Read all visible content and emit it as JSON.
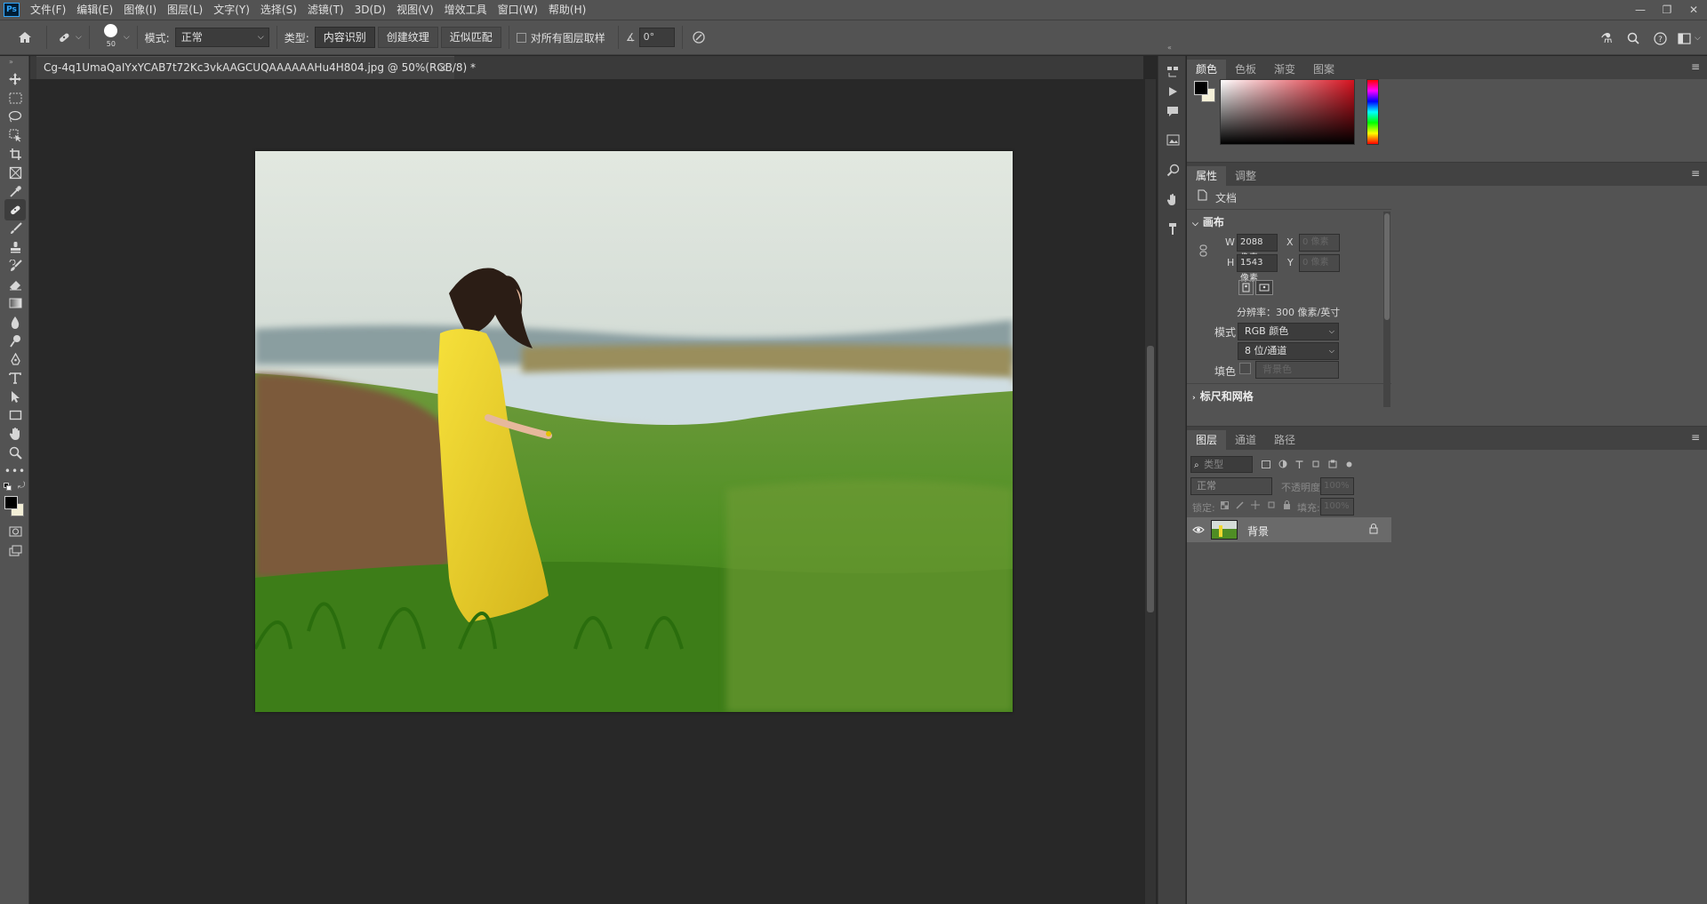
{
  "app": {
    "logo": "Ps",
    "menu": [
      "文件(F)",
      "编辑(E)",
      "图像(I)",
      "图层(L)",
      "文字(Y)",
      "选择(S)",
      "滤镜(T)",
      "3D(D)",
      "视图(V)",
      "增效工具",
      "窗口(W)",
      "帮助(H)"
    ],
    "window_controls": [
      "—",
      "❐",
      "✕"
    ]
  },
  "options": {
    "brush_size": "50",
    "mode_label": "模式:",
    "mode_value": "正常",
    "type_label": "类型:",
    "types": [
      "内容识别",
      "创建纹理",
      "近似匹配"
    ],
    "sample_all_layers": "对所有图层取样",
    "angle_value": "0°"
  },
  "document": {
    "tab_title": "Cg-4q1UmaQaIYxYCAB7t72Kc3vkAAGCUQAAAAAAHu4H804.jpg @ 50%(RGB/8) *",
    "close": "×"
  },
  "color_panel": {
    "tabs": [
      "颜色",
      "色板",
      "渐变",
      "图案"
    ],
    "foreground": "#000000",
    "background": "#f3efd7"
  },
  "properties_panel": {
    "tabs": [
      "属性",
      "调整"
    ],
    "doc_label": "文档",
    "canvas_section": "画布",
    "w_label": "W",
    "w_value": "2088 像素",
    "h_label": "H",
    "h_value": "1543 像素",
    "x_label": "X",
    "x_placeholder": "0 像素",
    "y_label": "Y",
    "y_placeholder": "0 像素",
    "resolution": "分辨率：300 像素/英寸",
    "mode_label": "模式",
    "mode_value": "RGB 颜色",
    "depth_value": "8 位/通道",
    "fill_label": "填色",
    "fill_value": "背景色",
    "rulers_section": "标尺和网格"
  },
  "layers_panel": {
    "tabs": [
      "图层",
      "通道",
      "路径"
    ],
    "filter_placeholder": "类型",
    "blend_mode": "正常",
    "opacity_label": "不透明度:",
    "opacity_value": "100%",
    "lock_label": "锁定:",
    "fill_label": "填充:",
    "fill_value": "100%",
    "layers": [
      {
        "name": "背景",
        "visible": true,
        "locked": true
      }
    ]
  }
}
